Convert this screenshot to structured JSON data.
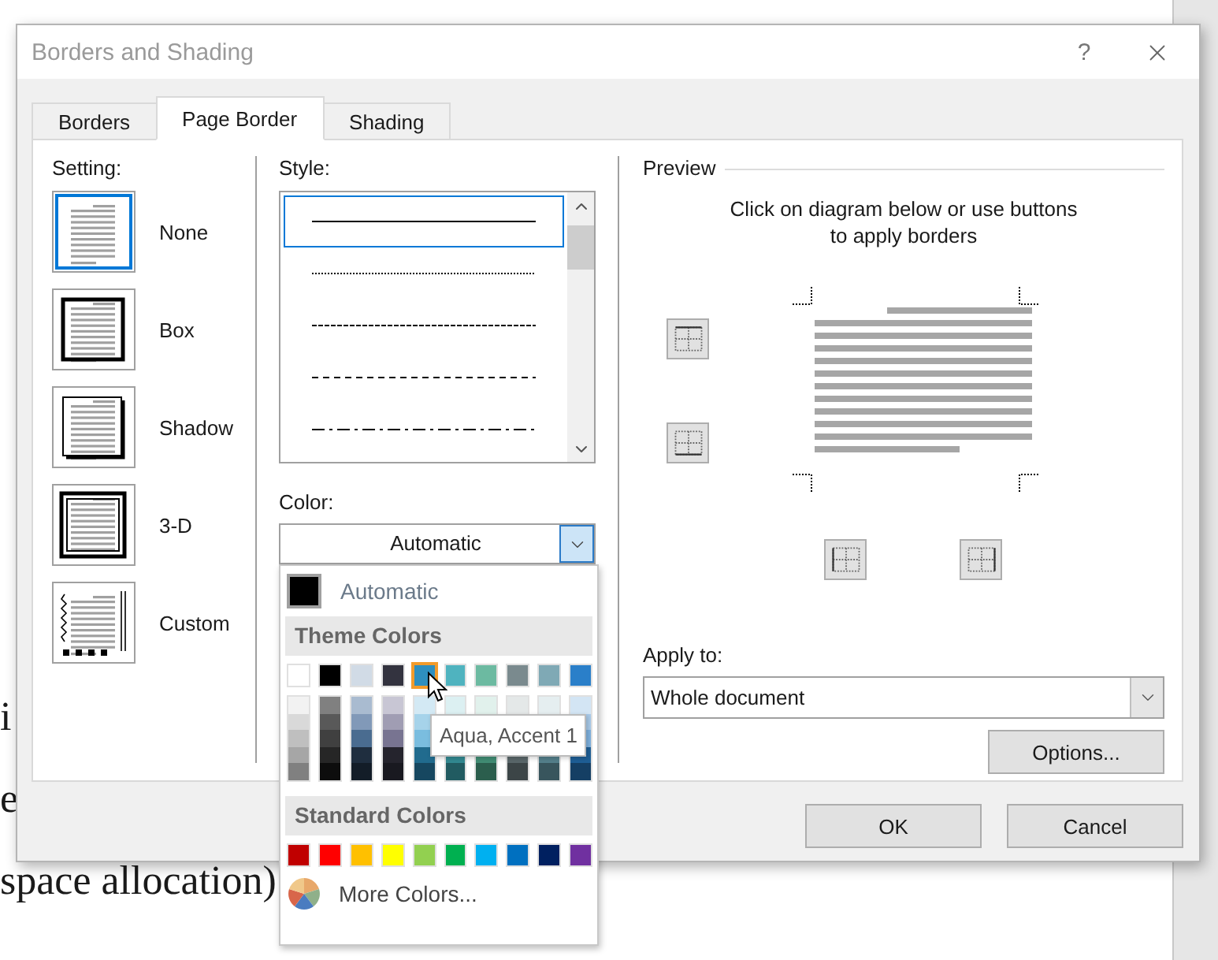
{
  "document": {
    "lines": [
      "i",
      "e",
      "space allocation)"
    ]
  },
  "dialog": {
    "title": "Borders and Shading",
    "help": "?"
  },
  "tabs": [
    {
      "label": "Borders",
      "selected": false
    },
    {
      "label": "Page Border",
      "selected": true
    },
    {
      "label": "Shading",
      "selected": false
    }
  ],
  "setting": {
    "label": "Setting:",
    "items": [
      {
        "kind": "none",
        "label": "None",
        "selected": true
      },
      {
        "kind": "box",
        "label": "Box",
        "selected": false
      },
      {
        "kind": "shadow",
        "label": "Shadow",
        "selected": false
      },
      {
        "kind": "double",
        "label": "3-D",
        "selected": false
      },
      {
        "kind": "custom",
        "label": "Custom",
        "selected": false
      }
    ]
  },
  "style": {
    "label": "Style:",
    "items": [
      {
        "kind": "solid",
        "selected": true
      },
      {
        "kind": "dotted",
        "selected": false
      },
      {
        "kind": "dashed",
        "selected": false
      },
      {
        "kind": "dash",
        "selected": false
      },
      {
        "kind": "dash-dot",
        "selected": false
      }
    ]
  },
  "color": {
    "label": "Color:",
    "value": "Automatic",
    "expanded": true
  },
  "color_menu": {
    "automatic": {
      "label": "Automatic",
      "color": "#000000"
    },
    "theme_header": "Theme Colors",
    "theme": [
      {
        "color": "#ffffff",
        "selected": false,
        "shades": [
          {
            "color": "#f2f2f2"
          },
          {
            "color": "#d9d9d9"
          },
          {
            "color": "#bfbfbf"
          },
          {
            "color": "#a6a6a6"
          },
          {
            "color": "#808080"
          }
        ]
      },
      {
        "color": "#000000",
        "selected": false,
        "shades": [
          {
            "color": "#808080"
          },
          {
            "color": "#595959"
          },
          {
            "color": "#404040"
          },
          {
            "color": "#262626"
          },
          {
            "color": "#0d0d0d"
          }
        ]
      },
      {
        "color": "#d1dbe6",
        "selected": false,
        "shades": [
          {
            "color": "#a9bbd0"
          },
          {
            "color": "#8199b8"
          },
          {
            "color": "#4a6c90"
          },
          {
            "color": "#1f2e3f"
          },
          {
            "color": "#131d28"
          }
        ]
      },
      {
        "color": "#33333f",
        "selected": false,
        "shades": [
          {
            "color": "#c8c6d4"
          },
          {
            "color": "#a09db3"
          },
          {
            "color": "#787491"
          },
          {
            "color": "#25242d"
          },
          {
            "color": "#191920"
          }
        ]
      },
      {
        "color": "#2e8fbf",
        "selected": true,
        "shades": [
          {
            "color": "#d3e9f4"
          },
          {
            "color": "#a6d3ea"
          },
          {
            "color": "#7abddf"
          },
          {
            "color": "#216b8e"
          },
          {
            "color": "#164760"
          }
        ]
      },
      {
        "color": "#4fb3bf",
        "selected": false,
        "shades_top": [
          {
            "color": "#dcf0f2"
          }
        ],
        "shades_bottom": [
          {
            "color": "#328991"
          },
          {
            "color": "#215b61"
          }
        ]
      },
      {
        "color": "#6cbaa1",
        "selected": false,
        "shades_top": [
          {
            "color": "#e1f1ec"
          }
        ],
        "shades_bottom": [
          {
            "color": "#418d74"
          },
          {
            "color": "#2b5e4d"
          }
        ]
      },
      {
        "color": "#7a8a8e",
        "selected": false,
        "shades_top": [
          {
            "color": "#e4e8e8"
          }
        ],
        "shades_bottom": [
          {
            "color": "#5a676a"
          },
          {
            "color": "#3c4547"
          }
        ]
      },
      {
        "color": "#7fa9b5",
        "selected": false,
        "shades_top": [
          {
            "color": "#e5eef0"
          }
        ],
        "shades_bottom": [
          {
            "color": "#547f8b"
          },
          {
            "color": "#38555d"
          }
        ]
      },
      {
        "color": "#2a7fc9",
        "selected": false,
        "shades": [
          {
            "color": "#d3e5f4"
          },
          {
            "color": "#a9cbea"
          },
          {
            "color": "#7fb2df"
          },
          {
            "color": "#1f5f96"
          },
          {
            "color": "#153f64"
          }
        ]
      }
    ],
    "standard_header": "Standard Colors",
    "standard": [
      {
        "color": "#c00000",
        "selected": false
      },
      {
        "color": "#ff0000",
        "selected": false
      },
      {
        "color": "#ffc000",
        "selected": false
      },
      {
        "color": "#ffff00",
        "selected": false
      },
      {
        "color": "#92d050",
        "selected": false
      },
      {
        "color": "#00b050",
        "selected": false
      },
      {
        "color": "#00b0f0",
        "selected": false
      },
      {
        "color": "#0070c0",
        "selected": false
      },
      {
        "color": "#002060",
        "selected": false
      },
      {
        "color": "#7030a0",
        "selected": false
      }
    ],
    "more": "More Colors...",
    "tooltip": "Aqua, Accent 1"
  },
  "preview": {
    "title": "Preview",
    "hint_lines": [
      "Click on diagram below or use buttons",
      "to apply borders"
    ]
  },
  "apply_to": {
    "label": "Apply to:",
    "value": "Whole document"
  },
  "buttons": {
    "options": "Options...",
    "ok": "OK",
    "cancel": "Cancel"
  }
}
